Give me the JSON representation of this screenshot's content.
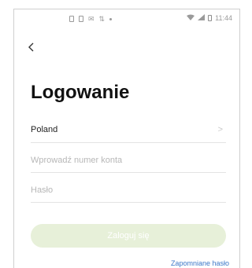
{
  "status_bar": {
    "time": "11:44",
    "left_icons": [
      "sim-icon",
      "sim-icon",
      "mail-icon",
      "signal-arrow-icon",
      "dot-icon"
    ],
    "right_icons": [
      "wifi-icon",
      "signal-icon",
      "battery-icon"
    ]
  },
  "header": {
    "back_icon": "chevron-left-icon"
  },
  "title": "Logowanie",
  "form": {
    "country_value": "Poland",
    "account_placeholder": "Wprowadź numer konta",
    "password_placeholder": "Hasło"
  },
  "login_button_label": "Zaloguj się",
  "forgot_link": "Zapomniane hasło",
  "colors": {
    "login_button_bg": "#e7f0d9",
    "link": "#3c78c8"
  }
}
